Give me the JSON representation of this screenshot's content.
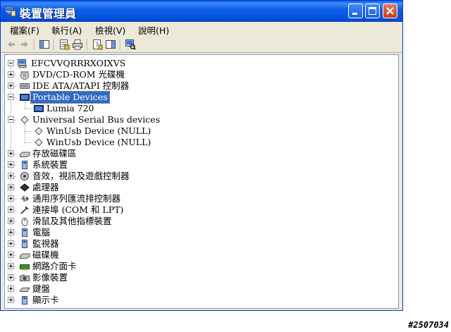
{
  "window": {
    "title": "裝置管理員",
    "menu": [
      {
        "label": "檔案(F)"
      },
      {
        "label": "執行(A)"
      },
      {
        "label": "檢視(V)"
      },
      {
        "label": "說明(H)"
      }
    ]
  },
  "tree": {
    "root": "EFCVVQRRRXOIXVS",
    "items": [
      {
        "label": "DVD/CD-ROM 光碟機",
        "icon": "cdrom-icon",
        "expander": "plus"
      },
      {
        "label": "IDE ATA/ATAPI 控制器",
        "icon": "ide-controller-icon",
        "expander": "plus"
      },
      {
        "label": "Portable Devices",
        "icon": "portable-device-icon",
        "expander": "minus",
        "selected": true
      },
      {
        "label": "Lumia 720",
        "icon": "phone-device-icon",
        "child": true
      },
      {
        "label": "Universal Serial Bus devices",
        "icon": "usb-diamond-icon",
        "expander": "minus"
      },
      {
        "label": "WinUsb Device (NULL)",
        "icon": "usb-diamond-icon",
        "child": true
      },
      {
        "label": "WinUsb Device (NULL)",
        "icon": "usb-diamond-icon",
        "child": true
      },
      {
        "label": "存放磁碟區",
        "icon": "storage-volume-icon",
        "expander": "plus"
      },
      {
        "label": "系統裝置",
        "icon": "system-device-icon",
        "expander": "plus"
      },
      {
        "label": "音效，視訊及遊戲控制器",
        "icon": "sound-icon",
        "expander": "plus"
      },
      {
        "label": "處理器",
        "icon": "processor-icon",
        "expander": "plus"
      },
      {
        "label": "通用序列匯流排控制器",
        "icon": "usb-controller-icon",
        "expander": "plus"
      },
      {
        "label": "連接埠 (COM 和 LPT)",
        "icon": "port-icon",
        "expander": "plus"
      },
      {
        "label": "滑鼠及其他指標裝置",
        "icon": "mouse-icon",
        "expander": "plus"
      },
      {
        "label": "電腦",
        "icon": "computer-icon",
        "expander": "plus"
      },
      {
        "label": "監視器",
        "icon": "monitor-icon",
        "expander": "plus"
      },
      {
        "label": "磁碟機",
        "icon": "disk-drive-icon",
        "expander": "plus"
      },
      {
        "label": "網路介面卡",
        "icon": "network-card-icon",
        "expander": "plus"
      },
      {
        "label": "影像裝置",
        "icon": "imaging-device-icon",
        "expander": "plus"
      },
      {
        "label": "鍵盤",
        "icon": "keyboard-icon",
        "expander": "plus"
      },
      {
        "label": "顯示卡",
        "icon": "display-adapter-icon",
        "expander": "plus"
      }
    ]
  },
  "watermark": "#2507034"
}
